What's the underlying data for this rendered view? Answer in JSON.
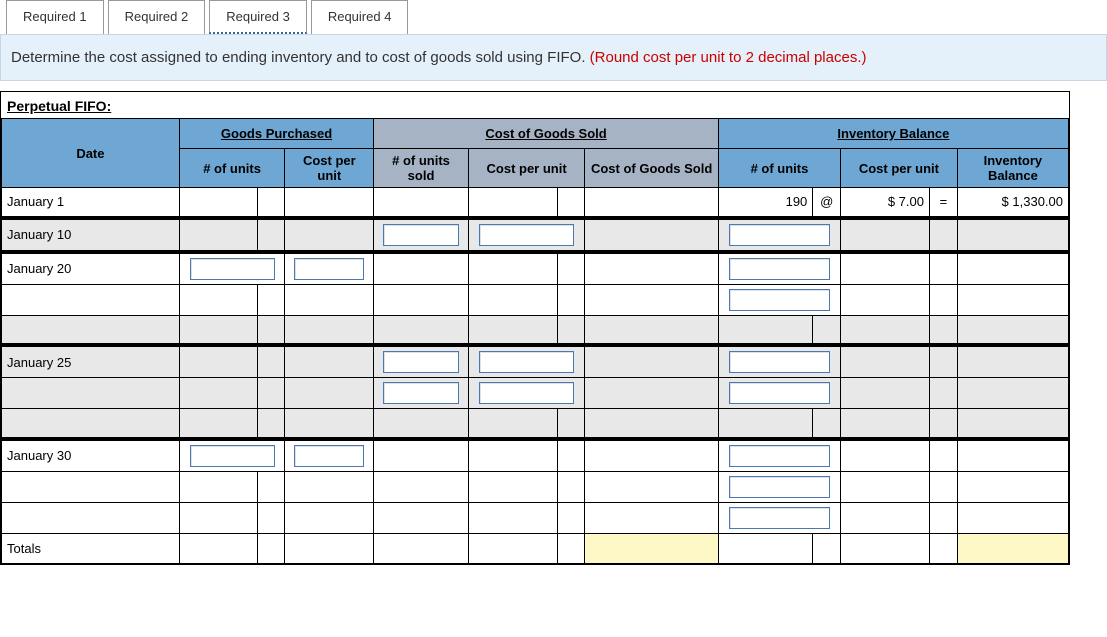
{
  "tabs": [
    {
      "label": "Required 1"
    },
    {
      "label": "Required 2"
    },
    {
      "label": "Required 3"
    },
    {
      "label": "Required 4"
    }
  ],
  "active_tab": "Required 3",
  "instruction": {
    "text": "Determine the cost assigned to ending inventory and to cost of goods sold using FIFO. ",
    "note": "(Round cost per unit to 2 decimal places.)"
  },
  "worksheet": {
    "title": "Perpetual FIFO:",
    "group_headers": {
      "date": "Date",
      "purchased": "Goods Purchased",
      "cogs": "Cost of Goods Sold",
      "inventory": "Inventory Balance"
    },
    "sub_headers": {
      "p_units": "# of units",
      "p_cpu": "Cost per unit",
      "cogs_units": "# of units sold",
      "cogs_cpu": "Cost per unit",
      "cogs_total": "Cost of Goods Sold",
      "inv_units": "# of units",
      "inv_cpu": "Cost per unit",
      "inv_bal": "Inventory Balance"
    },
    "rows": {
      "jan1": {
        "date": "January 1",
        "inv_units": "190",
        "inv_at": "@",
        "inv_cpu": "$   7.00",
        "inv_eq": "=",
        "inv_bal": "$ 1,330.00"
      },
      "jan10": {
        "date": "January 10"
      },
      "jan20": {
        "date": "January 20"
      },
      "jan25": {
        "date": "January 25"
      },
      "jan30": {
        "date": "January 30"
      },
      "totals": {
        "date": "Totals"
      }
    }
  }
}
